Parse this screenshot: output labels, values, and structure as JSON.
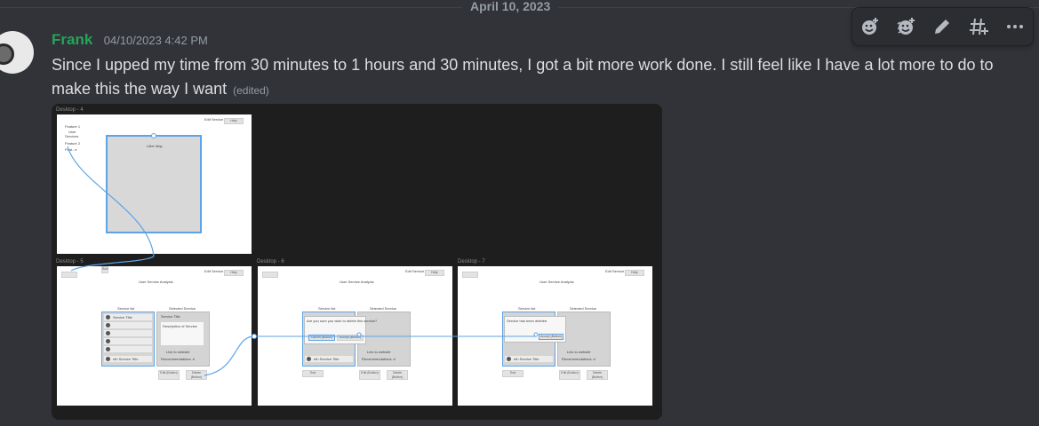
{
  "divider": {
    "date": "April 10, 2023"
  },
  "author": {
    "name": "Frank",
    "timestamp": "04/10/2023 4:42 PM"
  },
  "message": {
    "text": "Since I upped my time from 30 minutes to 1 hours and 30 minutes, I got a bit more work done. I still feel like I have a lot more to do to make this the way I want",
    "edited_label": "(edited)"
  },
  "toolbar": [
    {
      "icon": "add-reaction-icon"
    },
    {
      "icon": "super-reaction-icon"
    },
    {
      "icon": "edit-icon"
    },
    {
      "icon": "create-thread-icon"
    },
    {
      "icon": "more-icon"
    }
  ],
  "attachment": {
    "frames": {
      "desktop4": {
        "label": "Desktop - 4",
        "menu": [
          "Feature 1",
          "User",
          "Services",
          "Feature 2",
          "Feat...e"
        ],
        "map_title": "Litter Map",
        "top_link": "Edit Service",
        "top_button": "Help"
      },
      "desktop5": {
        "label": "Desktop - 5",
        "title": "User Service Analysis",
        "list_header": "Service list",
        "selected_header": "Selected Service",
        "first_item": "Service Title",
        "last_item": "nth Service Title",
        "selected_title": "Service Title",
        "description": "Description of Service",
        "link": "Link to website",
        "recs": "Recommendations: #",
        "sort": "Sort",
        "edit": "Edit (Button)",
        "delete": "Delete (Button)",
        "top_link": "Edit Service",
        "top_button": "Help"
      },
      "desktop6": {
        "label": "Desktop - 6",
        "title": "User Service Analysis",
        "list_header": "Service list",
        "selected_header": "Selected Service",
        "dialog_text": "Are you sure you wish to delete this service?",
        "cancel": "Cancel (Button)",
        "accept": "Accept (Button)",
        "last_item": "nth Service Title",
        "link": "Link to website",
        "recs": "Recommendations: #",
        "sort": "Sort",
        "edit": "Edit (Button)",
        "delete": "Delete (Button)",
        "top_link": "Edit Service",
        "top_button": "Help"
      },
      "desktop7": {
        "label": "Desktop - 7",
        "title": "User Service Analysis",
        "list_header": "Service list",
        "selected_header": "Selected Service",
        "dialog_text": "Service has been deleted",
        "accept": "Accept (Button)",
        "last_item": "nth Service Title",
        "link": "Link to website",
        "recs": "Recommendations: #",
        "sort": "Sort",
        "edit": "Edit (Button)",
        "delete": "Delete (Button)",
        "top_link": "Edit Service",
        "top_button": "Help"
      }
    }
  },
  "colors": {
    "background": "#313338",
    "username": "#23a559",
    "muted": "#949ba4",
    "text": "#dbdee1",
    "prototype_link": "#5da3e6"
  }
}
